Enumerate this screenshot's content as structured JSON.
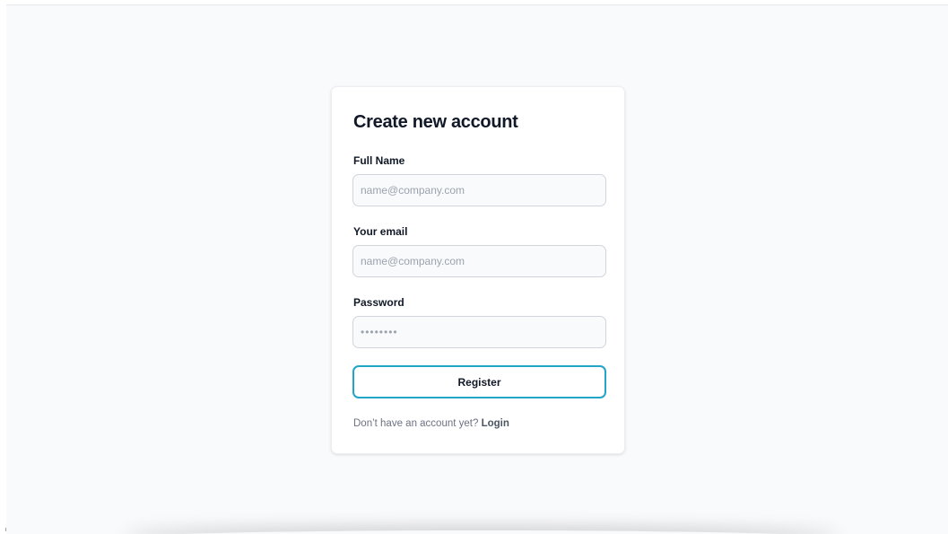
{
  "form": {
    "title": "Create new account",
    "full_name": {
      "label": "Full Name",
      "placeholder": "name@company.com",
      "value": ""
    },
    "email": {
      "label": "Your email",
      "placeholder": "name@company.com",
      "value": ""
    },
    "password": {
      "label": "Password",
      "placeholder": "••••••••",
      "value": ""
    },
    "register_label": "Register",
    "footer": {
      "prompt": "Don’t have an account yet?",
      "link_label": "Login"
    }
  },
  "colors": {
    "background": "#f9fafb",
    "card": "#ffffff",
    "button_border": "#22a5c7",
    "text_primary": "#111827",
    "text_muted": "#6b7280"
  }
}
